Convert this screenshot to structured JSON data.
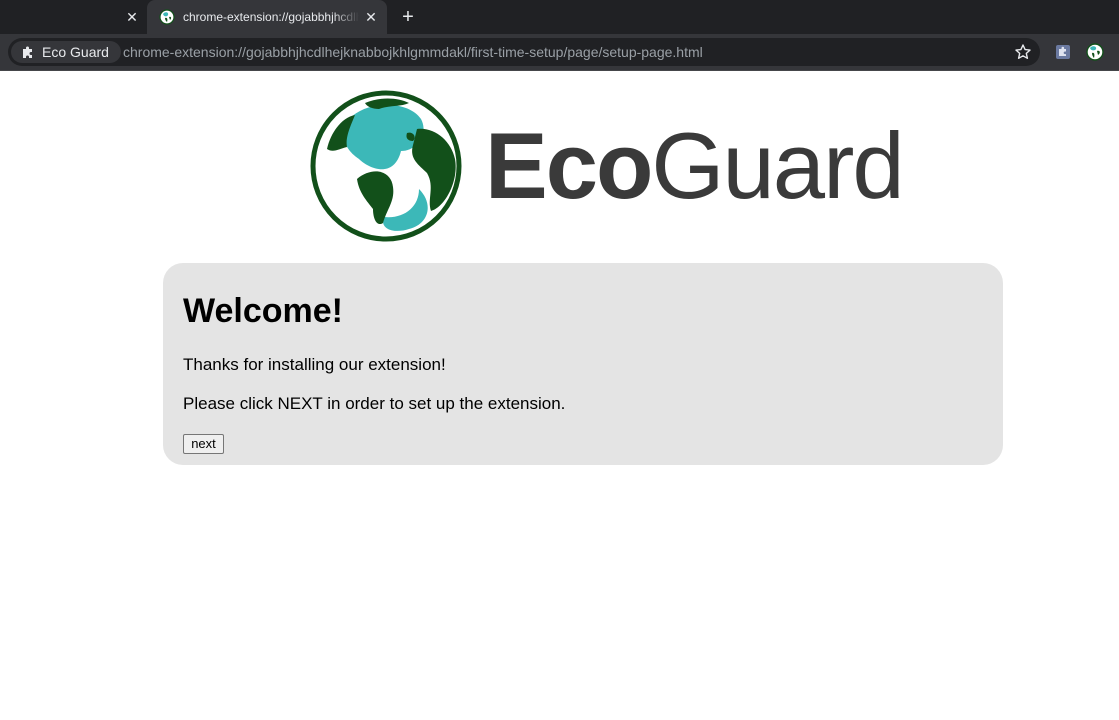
{
  "browser": {
    "tabs": [
      {
        "title": "",
        "active": false
      },
      {
        "title": "chrome-extension://gojabbhjhcdlhejknabbojkhlgmmdakl",
        "active": true
      }
    ],
    "omnibox": {
      "chip_label": "Eco Guard",
      "url": "chrome-extension://gojabbhjhcdlhejknabbojkhlgmmdakl/first-time-setup/page/setup-page.html"
    },
    "icons": {
      "tab_close": "close-icon",
      "new_tab": "plus-icon",
      "chip": "puzzle-icon",
      "bookmark": "star-icon",
      "extensions": [
        "puzzle-extension-icon",
        "eco-guard-globe-icon"
      ]
    }
  },
  "logo": {
    "eco": "Eco",
    "guard": "Guard",
    "colors": {
      "dark_green": "#12501a",
      "teal": "#3cb8b8",
      "text": "#3a3a3a"
    }
  },
  "card": {
    "heading": "Welcome!",
    "line1": "Thanks for installing our extension!",
    "line2": "Please click NEXT in order to set up the extension.",
    "button_label": "next",
    "background": "#e4e4e4"
  }
}
